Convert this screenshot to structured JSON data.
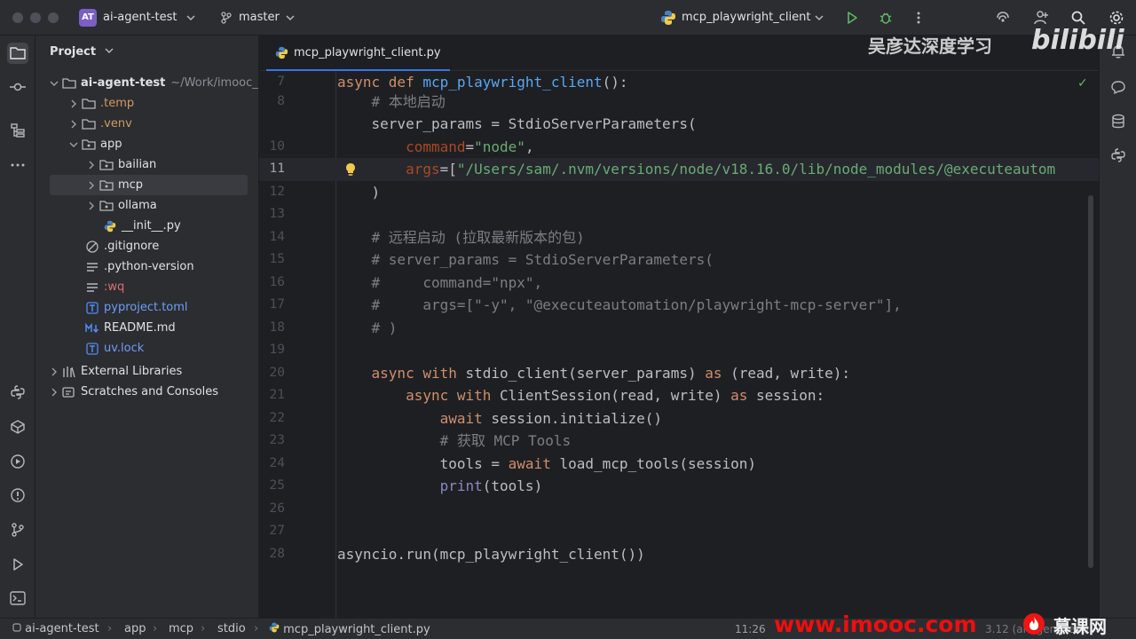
{
  "titlebar": {
    "project_badge": "AT",
    "project_name": "ai-agent-test",
    "branch": "master",
    "run_config": "mcp_playwright_client"
  },
  "watermarks": {
    "top_text": "吴彦达深度学习",
    "bilibili": "bilibili",
    "imooc": "www.imooc.com",
    "imooc_cn": "慕课网"
  },
  "project_panel": {
    "title": "Project",
    "tree": [
      {
        "label": "ai-agent-test",
        "suffix": "~/Work/imooc_",
        "type": "folder",
        "expanded": true
      },
      {
        "label": ".temp",
        "type": "folder-excluded"
      },
      {
        "label": ".venv",
        "type": "folder-excluded"
      },
      {
        "label": "app",
        "type": "folder",
        "expanded": true
      },
      {
        "label": "bailian",
        "type": "folder"
      },
      {
        "label": "mcp",
        "type": "folder",
        "selected": true
      },
      {
        "label": "ollama",
        "type": "folder"
      },
      {
        "label": "__init__.py",
        "type": "python"
      },
      {
        "label": ".gitignore",
        "type": "ignore"
      },
      {
        "label": ".python-version",
        "type": "text"
      },
      {
        "label": ":wq",
        "type": "text-red"
      },
      {
        "label": "pyproject.toml",
        "type": "toml"
      },
      {
        "label": "README.md",
        "type": "markdown"
      },
      {
        "label": "uv.lock",
        "type": "lock"
      },
      {
        "label": "External Libraries",
        "type": "library"
      },
      {
        "label": "Scratches and Consoles",
        "type": "scratch"
      }
    ]
  },
  "editor": {
    "tab_label": "mcp_playwright_client.py",
    "current_line": 11,
    "line_numbers": [
      "7",
      "8",
      "10",
      "11",
      "12",
      "13",
      "14",
      "15",
      "16",
      "17",
      "18",
      "19",
      "20",
      "21",
      "22",
      "23",
      "24",
      "25",
      "26",
      "27",
      "28"
    ]
  },
  "statusbar": {
    "breadcrumb": [
      "ai-agent-test",
      "app",
      "mcp",
      "stdio",
      "mcp_playwright_client.py"
    ],
    "cursor": "11:26",
    "interpreter": "3.12 (ai-agent-test)"
  },
  "colors": {
    "keyword": "#cf8e6d",
    "function": "#56a8f5",
    "string": "#6aab73",
    "comment": "#7a7e85",
    "parameter": "#aa4926",
    "accent": "#3574f0"
  }
}
